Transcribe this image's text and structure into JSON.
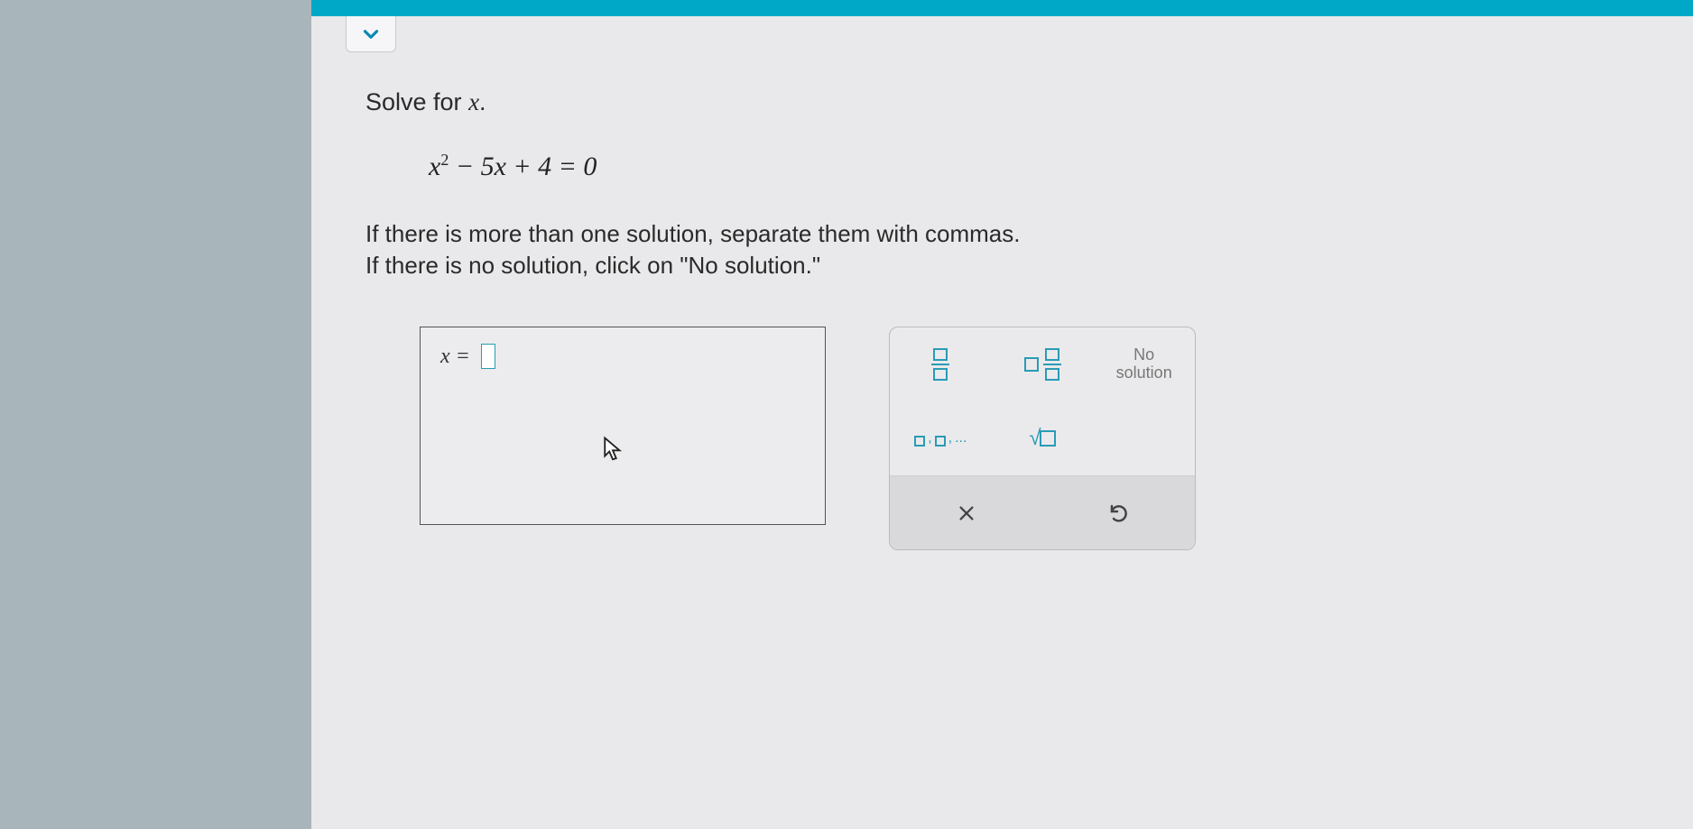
{
  "prompt": {
    "text_prefix": "Solve for ",
    "variable": "x",
    "text_suffix": "."
  },
  "equation": {
    "base1": "x",
    "exp1": "2",
    "middle": " − 5",
    "base2": "x",
    "tail": " + 4 = 0"
  },
  "instructions": {
    "line1": "If there is more than one solution, separate them with commas.",
    "line2": "If there is no solution, click on \"No solution.\""
  },
  "answer": {
    "label": "x =",
    "value": ""
  },
  "keypad": {
    "no_solution": "No\nsolution",
    "clear": "×",
    "undo": "↶",
    "list_tail": ",...",
    "sqrt": "√"
  }
}
